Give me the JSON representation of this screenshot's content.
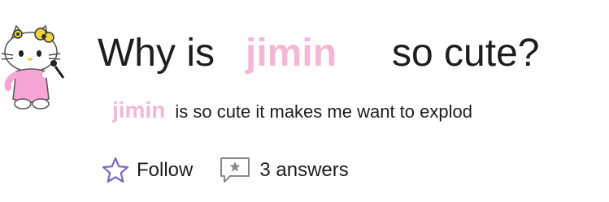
{
  "question": {
    "prefix": "Why is",
    "name": "jimin",
    "suffix": "so cute?"
  },
  "answer": {
    "name": "jimin",
    "text": "is so cute it makes me want to explod"
  },
  "actions": {
    "follow_label": "Follow",
    "answers_label": "3 answers"
  },
  "icons": {
    "avatar": "hello-kitty-avatar",
    "follow": "star-outline-icon",
    "answers": "comment-star-icon"
  },
  "colors": {
    "accent_pink": "#f3b8d6",
    "star_purple": "#7b66c9",
    "text": "#1e1e1e"
  }
}
